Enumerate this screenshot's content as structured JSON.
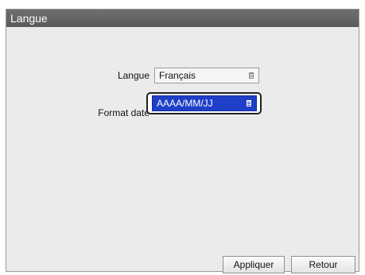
{
  "window": {
    "title": "Langue"
  },
  "form": {
    "language": {
      "label": "Langue",
      "value": "Français"
    },
    "date_format": {
      "label": "Format date",
      "value": "AAAA/MM/JJ"
    }
  },
  "buttons": {
    "apply_label": "Appliquer",
    "back_label": "Retour"
  },
  "colors": {
    "titlebar": "#5f5f5f",
    "panel": "#ebebeb",
    "selection": "#1f3fc8"
  }
}
